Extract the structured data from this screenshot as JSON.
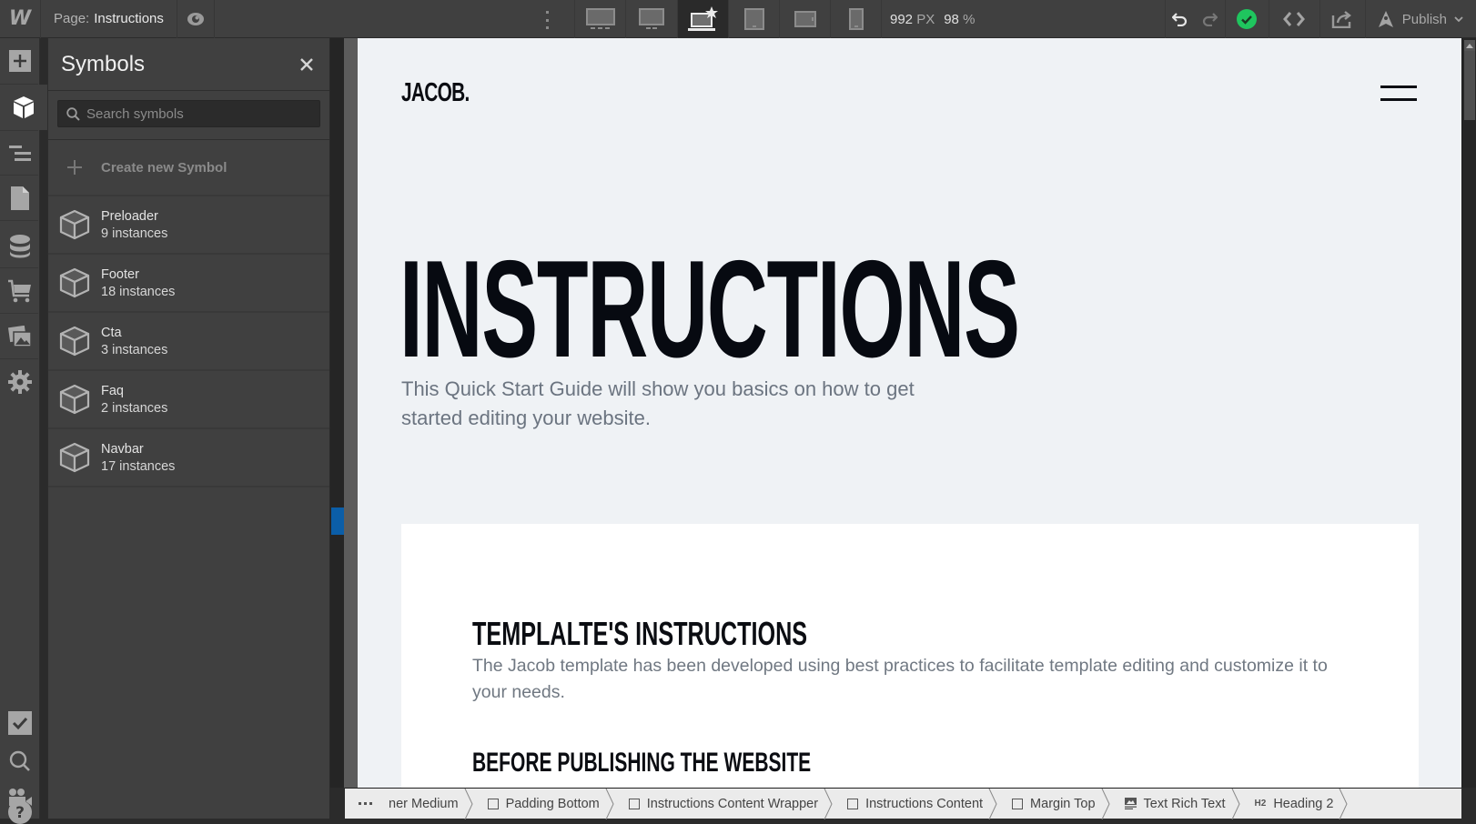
{
  "topbar": {
    "logo": "W",
    "page_prefix": "Page:",
    "page_name": "Instructions",
    "breakpoints": [
      {
        "name": "desktop-xl",
        "active": false
      },
      {
        "name": "desktop-lg",
        "active": false
      },
      {
        "name": "desktop-base",
        "active": true
      },
      {
        "name": "tablet",
        "active": false
      },
      {
        "name": "mobile-landscape",
        "active": false
      },
      {
        "name": "mobile-portrait",
        "active": false
      }
    ],
    "width_value": "992",
    "width_unit": "PX",
    "zoom_value": "98",
    "zoom_unit": "%",
    "publish_label": "Publish",
    "status_color": "#1fc55e"
  },
  "rail": {
    "items": [
      {
        "name": "add-elements",
        "icon": "plus-icon"
      },
      {
        "name": "symbols",
        "icon": "cube-icon",
        "active": true
      },
      {
        "name": "navigator",
        "icon": "navigator-icon"
      },
      {
        "name": "pages",
        "icon": "page-icon"
      },
      {
        "name": "cms",
        "icon": "database-icon"
      },
      {
        "name": "ecommerce",
        "icon": "cart-icon"
      },
      {
        "name": "assets",
        "icon": "images-icon"
      },
      {
        "name": "settings",
        "icon": "gear-icon"
      },
      {
        "name": "audit",
        "icon": "checkbox-icon"
      },
      {
        "name": "search",
        "icon": "search-icon"
      },
      {
        "name": "tutorials",
        "icon": "video-camera-icon"
      },
      {
        "name": "help",
        "icon": "help-icon"
      }
    ]
  },
  "symbols_panel": {
    "title": "Symbols",
    "search_placeholder": "Search symbols",
    "search_value": "",
    "create_label": "Create new Symbol",
    "items": [
      {
        "name": "Preloader",
        "count": "9 instances"
      },
      {
        "name": "Footer",
        "count": "18 instances"
      },
      {
        "name": "Cta",
        "count": "3 instances"
      },
      {
        "name": "Faq",
        "count": "2 instances"
      },
      {
        "name": "Navbar",
        "count": "17 instances"
      }
    ]
  },
  "canvas": {
    "brand": "JACOB.",
    "hero_title": "INSTRUCTIONS",
    "hero_subtitle": "This Quick Start Guide will show you basics on how to get started editing your website.",
    "card": {
      "heading": "TEMPLALTE'S INSTRUCTIONS",
      "paragraph": "The Jacob template has been developed using best practices to facilitate template editing and customize it to your needs.",
      "subheading": "BEFORE PUBLISHING THE WEBSITE"
    }
  },
  "breadcrumbs": [
    {
      "label": "ner Medium",
      "icon": null
    },
    {
      "label": "Padding Bottom",
      "icon": "box-icon"
    },
    {
      "label": "Instructions Content Wrapper",
      "icon": "box-icon"
    },
    {
      "label": "Instructions Content",
      "icon": "box-icon"
    },
    {
      "label": "Margin Top",
      "icon": "box-icon"
    },
    {
      "label": "Text Rich Text",
      "icon": "rich-text-icon"
    },
    {
      "label": "Heading 2",
      "icon": "h2-icon",
      "tag": "H2"
    }
  ]
}
